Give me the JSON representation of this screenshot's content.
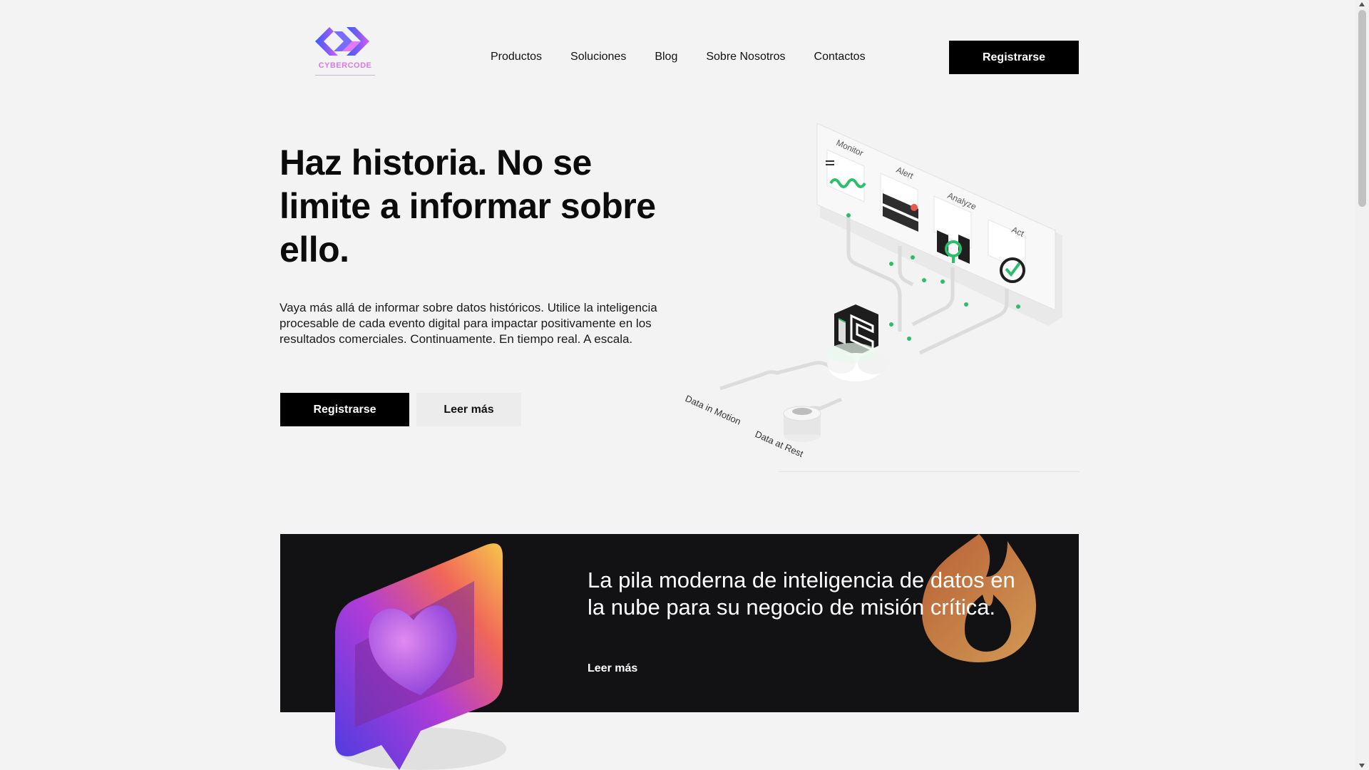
{
  "brand": {
    "name": "CYBERCODE",
    "tagline": ""
  },
  "nav": {
    "items": [
      "Productos",
      "Soluciones",
      "Blog",
      "Sobre Nosotros",
      "Contactos"
    ],
    "cta": "Registrarse"
  },
  "hero": {
    "title": "Haz historia. No se limite a informar sobre ello.",
    "text": "Vaya más allá de informar sobre datos históricos. Utilice la inteligencia procesable de cada evento digital para impactar positivamente en los resultados comerciales. Continuamente. En tiempo real. A escala.",
    "primary_button": "Registrarse",
    "secondary_button": "Leer más",
    "illustration": {
      "stages": [
        "Monitor",
        "Alert",
        "Analyze",
        "Act"
      ],
      "data_labels": [
        "Data in Motion",
        "Data at Rest"
      ]
    }
  },
  "banner": {
    "title": "La pila moderna de inteligencia de datos en la nube para su negocio de misión crítica.",
    "link": "Leer más"
  },
  "colors": {
    "accent_black": "#000000",
    "banner_bg": "#121214",
    "logo_gradient_start": "#3b5bff",
    "logo_gradient_end": "#e05bf0",
    "highlight_green": "#2bbf6a"
  }
}
